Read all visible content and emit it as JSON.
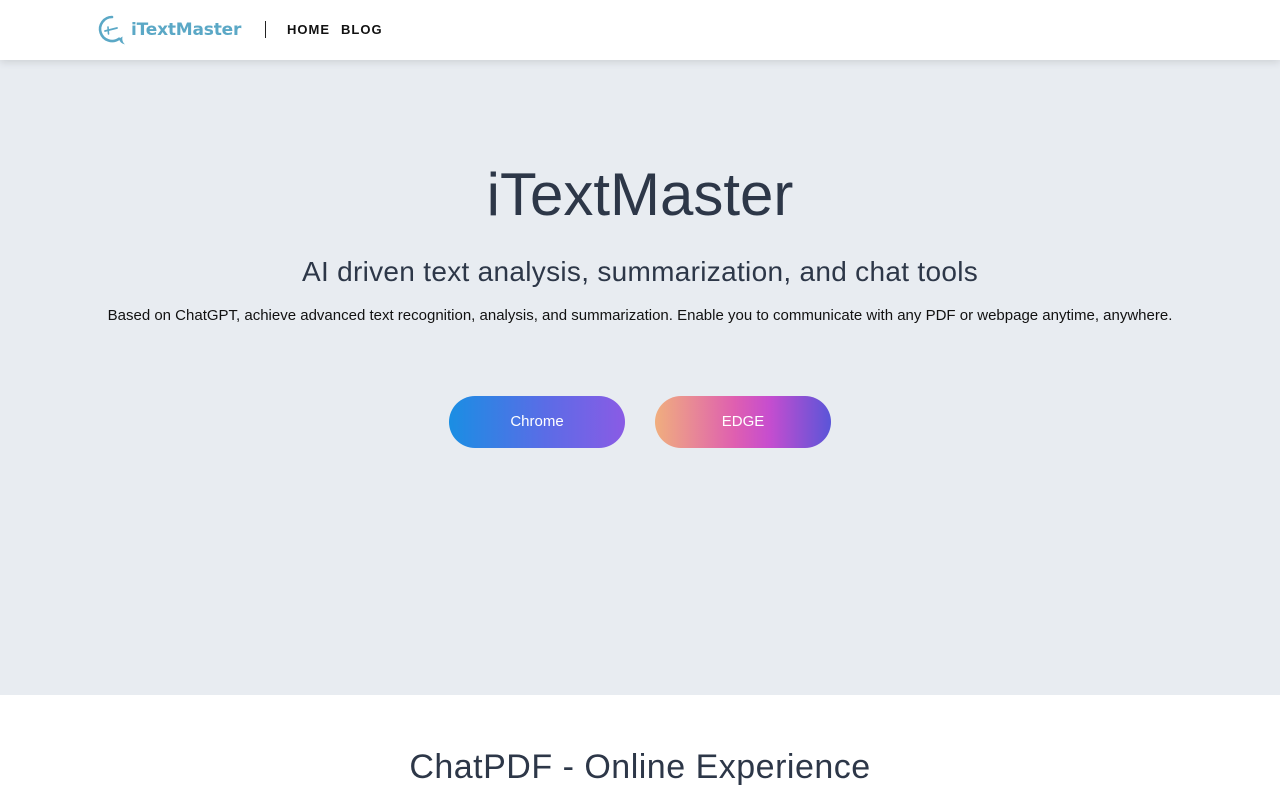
{
  "header": {
    "logo_text": "iTextMaster",
    "logo_icon": "chat-bubble-logo-icon",
    "nav": [
      {
        "label": "HOME"
      },
      {
        "label": "BLOG"
      }
    ]
  },
  "hero": {
    "title": "iTextMaster",
    "subtitle": "AI driven text analysis, summarization, and chat tools",
    "description": "Based on ChatGPT, achieve advanced text recognition, analysis, and summarization. Enable you to communicate with any PDF or webpage anytime, anywhere.",
    "buttons": {
      "chrome_label": "Chrome",
      "edge_label": "EDGE"
    }
  },
  "section2": {
    "title": "ChatPDF - Online Experience"
  },
  "colors": {
    "brand": "#5ba8c6",
    "hero_background": "#e8ecf1",
    "heading_text": "#2d3748"
  }
}
